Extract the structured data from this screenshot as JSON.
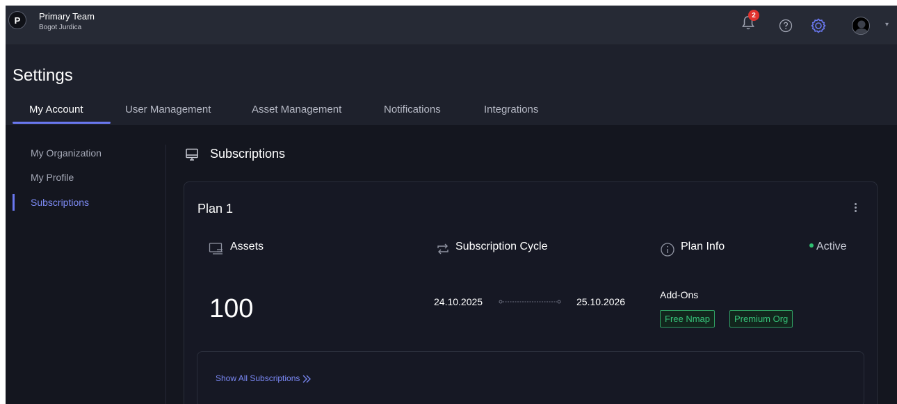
{
  "team": {
    "avatar_letter": "P",
    "name": "Primary Team",
    "user": "Bogot Jurdica"
  },
  "topbar": {
    "notification_count": "2",
    "icons": [
      "bell-icon",
      "help-icon",
      "gear-icon",
      "user-avatar",
      "caret-down-icon"
    ],
    "caret": "▾"
  },
  "page": {
    "title": "Settings"
  },
  "tabs": [
    {
      "label": "My Account",
      "active": true
    },
    {
      "label": "User Management"
    },
    {
      "label": "Asset Management"
    },
    {
      "label": "Notifications"
    },
    {
      "label": "Integrations"
    }
  ],
  "sidebar": {
    "items": [
      {
        "label": "My Organization"
      },
      {
        "label": "My Profile"
      },
      {
        "label": "Subscriptions",
        "active": true
      }
    ]
  },
  "section": {
    "title": "Subscriptions",
    "icon": "monitor-icon"
  },
  "plan": {
    "name": "Plan 1",
    "columns": {
      "assets": {
        "label": "Assets",
        "icon": "assets-icon",
        "value": "100"
      },
      "cycle": {
        "label": "Subscription Cycle",
        "icon": "repeat-icon",
        "start": "24.10.2025",
        "end": "25.10.2026"
      },
      "info": {
        "label": "Plan Info",
        "icon": "info-icon"
      }
    },
    "status": "Active",
    "addons_label": "Add-Ons",
    "addons": [
      "Free Nmap",
      "Premium Org"
    ]
  },
  "footer": {
    "show_all": "Show All Subscriptions"
  },
  "colors": {
    "accent": "#6a78f0",
    "active_green": "#2fbf71",
    "badge_red": "#e0332f",
    "addon_green": "#37c47a"
  }
}
